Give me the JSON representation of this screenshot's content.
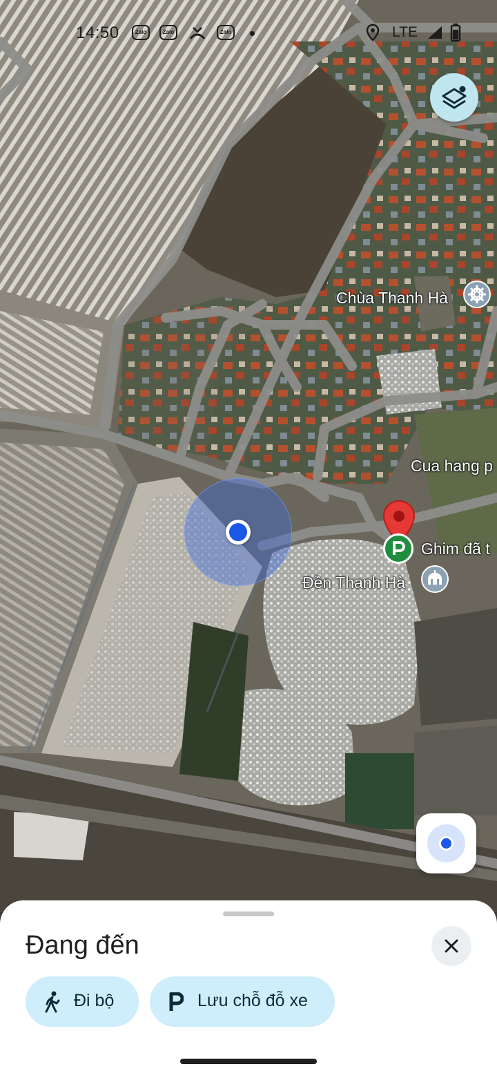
{
  "status_bar": {
    "time": "14:50",
    "zalo_label": "Zalo",
    "network": "LTE",
    "icons": [
      "zalo-icon",
      "zalo-icon",
      "missed-call-icon",
      "zalo-icon",
      "location-icon",
      "signal-icon",
      "battery-icon"
    ]
  },
  "map": {
    "mode": "satellite",
    "layers_icon": "layers-icon",
    "labels": {
      "chua": "Chùa Thanh Hà",
      "cua_hang": "Cua hang p",
      "ghim": "Ghim đã t",
      "den": "Đền Thanh Hà"
    },
    "pin_color": "#e53935",
    "parking_color": "#1e8e3e",
    "my_location_icon": "my-location-icon"
  },
  "sheet": {
    "title": "Đang đến",
    "close_icon": "close-icon",
    "chips": {
      "walk": {
        "label": "Đi bộ",
        "icon": "walk-icon"
      },
      "parking": {
        "label": "Lưu chỗ đỗ xe",
        "icon": "parking-icon"
      }
    }
  },
  "colors": {
    "accent_blue": "#1a56e8",
    "chip_bg": "#cdeefa",
    "layers_bg": "#bfe6ef",
    "poi_gray": "#8da1b4"
  }
}
